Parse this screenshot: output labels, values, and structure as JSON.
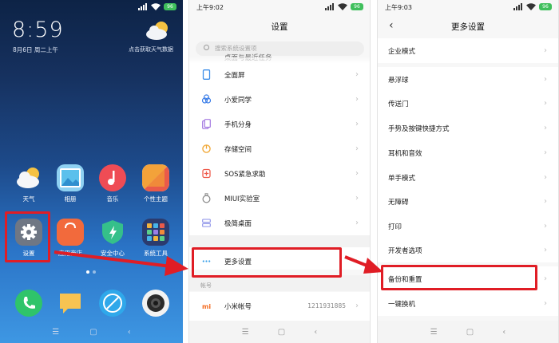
{
  "home": {
    "time": "8:59",
    "date": "8月6日 周二上午",
    "weather_hint": "点击获取天气数据",
    "battery": "96",
    "apps_row1": [
      {
        "label": "天气",
        "icon": "weather-icon"
      },
      {
        "label": "相册",
        "icon": "gallery-icon"
      },
      {
        "label": "音乐",
        "icon": "music-icon"
      },
      {
        "label": "个性主题",
        "icon": "themes-icon"
      }
    ],
    "apps_row2": [
      {
        "label": "设置",
        "icon": "settings-gear-icon"
      },
      {
        "label": "应用商店",
        "icon": "app-store-icon"
      },
      {
        "label": "安全中心",
        "icon": "security-shield-icon"
      },
      {
        "label": "系统工具",
        "icon": "system-tools-icon"
      }
    ],
    "dock": [
      {
        "icon": "phone-icon"
      },
      {
        "icon": "messages-icon"
      },
      {
        "icon": "browser-icon"
      },
      {
        "icon": "camera-icon"
      }
    ]
  },
  "settings": {
    "status_time": "上午9:02",
    "battery": "96",
    "title": "设置",
    "search_placeholder": "搜索系统设置项",
    "partial_item": "桌面与最近任务",
    "items": [
      {
        "label": "全面屏",
        "icon": "fullscreen-icon",
        "icon_color": "#3d8ee8"
      },
      {
        "label": "小爱同学",
        "icon": "xiaoai-icon",
        "icon_color": "#3a7de8"
      },
      {
        "label": "手机分身",
        "icon": "second-space-icon",
        "icon_color": "#a277e0"
      },
      {
        "label": "存储空间",
        "icon": "storage-icon",
        "icon_color": "#f0a530"
      },
      {
        "label": "SOS紧急求助",
        "icon": "sos-icon",
        "icon_color": "#ef5b4c"
      },
      {
        "label": "MIUI实验室",
        "icon": "lab-icon",
        "icon_color": "#888888"
      },
      {
        "label": "极简桌面",
        "icon": "simple-mode-icon",
        "icon_color": "#8a8fe8"
      },
      {
        "label": "更多设置",
        "icon": "more-settings-icon",
        "icon_color": "#3aa0e8"
      }
    ],
    "account_section": "帐号",
    "account_item": {
      "label": "小米帐号",
      "value": "1211931885",
      "icon": "mi-account-icon",
      "icon_color": "#f46b20"
    }
  },
  "more_settings": {
    "status_time": "上午9:03",
    "battery": "96",
    "title": "更多设置",
    "items": [
      {
        "label": "企业模式"
      },
      {
        "label": "悬浮球"
      },
      {
        "label": "传送门"
      },
      {
        "label": "手势及按键快捷方式"
      },
      {
        "label": "耳机和音效"
      },
      {
        "label": "单手模式"
      },
      {
        "label": "无障碍"
      },
      {
        "label": "打印"
      },
      {
        "label": "开发者选项"
      },
      {
        "label": "备份和重置"
      },
      {
        "label": "一键换机"
      }
    ]
  },
  "colors": {
    "highlight": "#e01d25",
    "accent_green": "#3fbf5c"
  }
}
